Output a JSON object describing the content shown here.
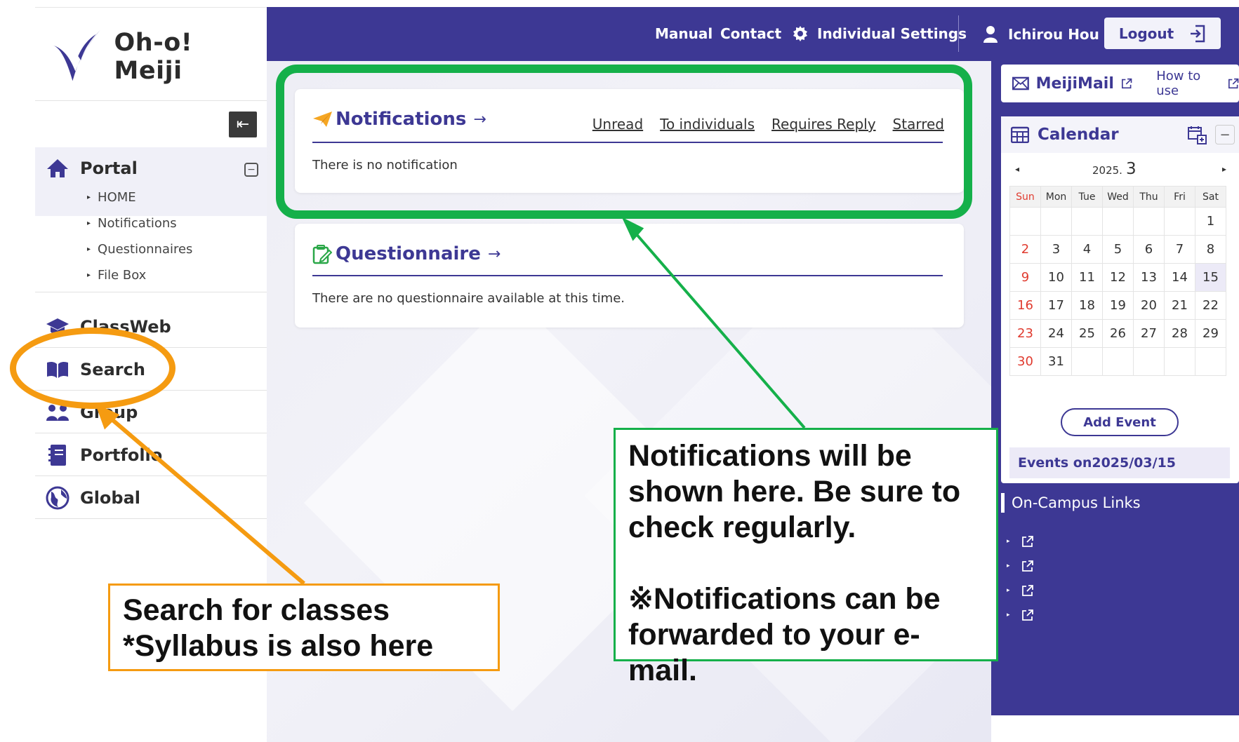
{
  "app": {
    "logo_text": "Oh-o! Meiji"
  },
  "sidebar": {
    "collapse_label": "⇤",
    "portal": {
      "label": "Portal",
      "toggle": "−",
      "items": [
        "HOME",
        "Notifications",
        "Questionnaires",
        "File Box"
      ]
    },
    "menu": [
      {
        "label": "ClassWeb",
        "icon": "graduation-cap-icon"
      },
      {
        "label": "Search",
        "icon": "open-book-icon"
      },
      {
        "label": "Group",
        "icon": "group-icon"
      },
      {
        "label": "Portfolio",
        "icon": "notebook-icon"
      },
      {
        "label": "Global",
        "icon": "globe-icon"
      }
    ]
  },
  "topbar": {
    "manual": "Manual",
    "contact": "Contact",
    "settings": "Individual Settings",
    "user": "Ichirou Hou",
    "logout": "Logout",
    "background_color": "#3d3894"
  },
  "notifications": {
    "title": "Notifications",
    "arrow": "→",
    "filters": [
      "Unread",
      "To individuals",
      "Requires Reply",
      "Starred"
    ],
    "empty_message": "There is no notification"
  },
  "questionnaire": {
    "title": "Questionnaire",
    "arrow": "→",
    "empty_message": "There are no questionnaire available at this time."
  },
  "right_panel": {
    "mail_label": "MeijiMail",
    "how_to_use": "How to use",
    "calendar": {
      "title": "Calendar",
      "minus": "−",
      "prev": "◂",
      "next": "▸",
      "year": "2025.",
      "month": "3",
      "weekdays": [
        "Sun",
        "Mon",
        "Tue",
        "Wed",
        "Thu",
        "Fri",
        "Sat"
      ],
      "weeks": [
        [
          "",
          "",
          "",
          "",
          "",
          "",
          "1"
        ],
        [
          "2",
          "3",
          "4",
          "5",
          "6",
          "7",
          "8"
        ],
        [
          "9",
          "10",
          "11",
          "12",
          "13",
          "14",
          "15"
        ],
        [
          "16",
          "17",
          "18",
          "19",
          "20",
          "21",
          "22"
        ],
        [
          "23",
          "24",
          "25",
          "26",
          "27",
          "28",
          "29"
        ],
        [
          "30",
          "31",
          "",
          "",
          "",
          "",
          ""
        ]
      ],
      "today": "15",
      "add_event": "Add Event",
      "events_on": "Events on2025/03/15"
    },
    "links_title": "On-Campus Links",
    "link_count": 4
  },
  "annotations": {
    "green_callout_lines": [
      "Notifications will be",
      "shown here. Be sure to",
      "check regularly.",
      "",
      "※Notifications can be",
      "forwarded to your e-mail."
    ],
    "orange_callout_lines": [
      "Search for classes",
      "*Syllabus is also here"
    ],
    "green_color": "#15b04a",
    "orange_color": "#f59b11"
  }
}
